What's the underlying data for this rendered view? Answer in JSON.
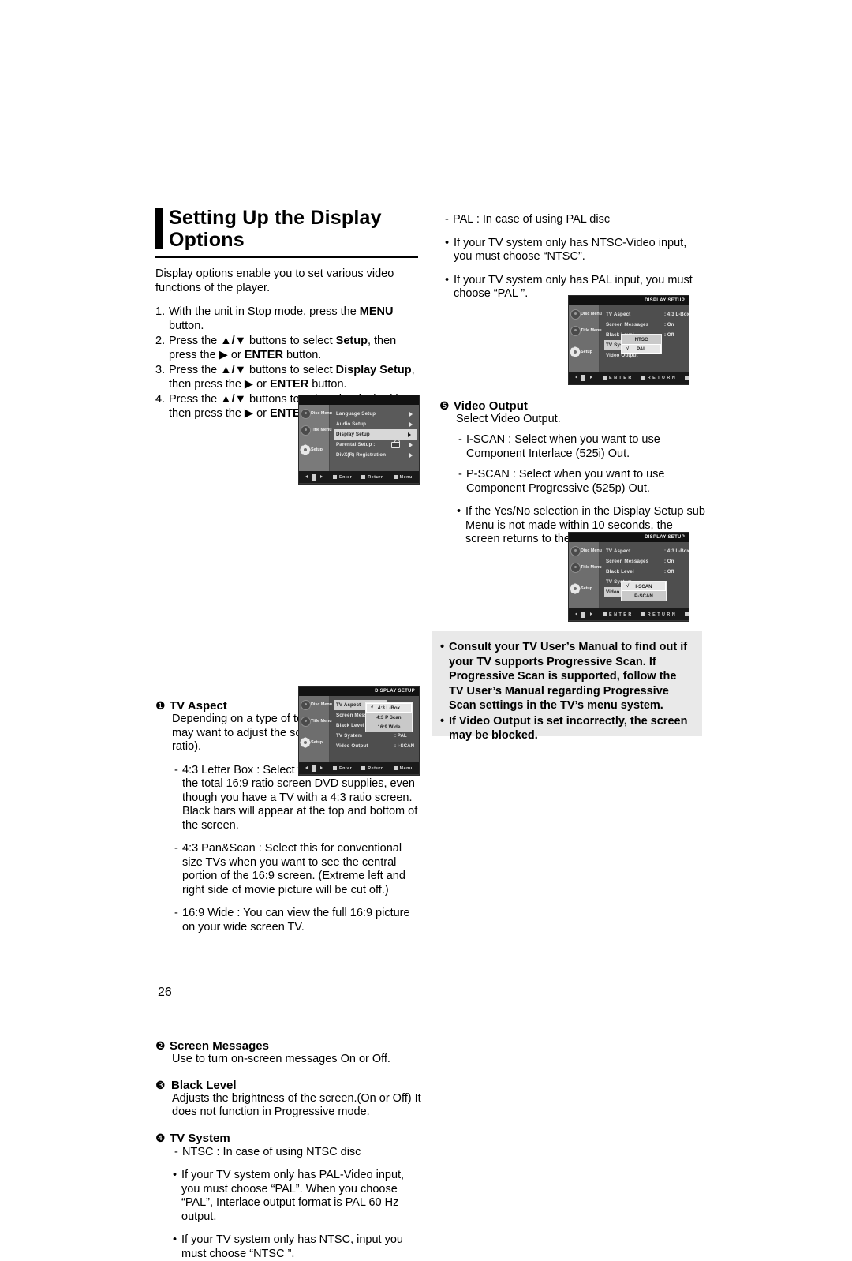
{
  "page": {
    "number": "26"
  },
  "heading": {
    "line1": "Setting Up the Display",
    "line2": "Options"
  },
  "intro": "Display options enable you to set various video functions of the player.",
  "steps": [
    {
      "num": "1.",
      "parts": [
        {
          "t": "With the unit in Stop mode, press the ",
          "b": false
        },
        {
          "t": "MENU",
          "b": true
        },
        {
          "t": " button.",
          "b": false
        }
      ]
    },
    {
      "num": "2.",
      "parts": [
        {
          "t": "Press the ",
          "b": false
        },
        {
          "t": "▲/▼",
          "b": true
        },
        {
          "t": " buttons to select ",
          "b": false
        },
        {
          "t": "Setup",
          "b": true
        },
        {
          "t": ", then press the ▶ or ",
          "b": false
        },
        {
          "t": "ENTER",
          "b": true
        },
        {
          "t": " button.",
          "b": false
        }
      ]
    },
    {
      "num": "3.",
      "parts": [
        {
          "t": "Press the ",
          "b": false
        },
        {
          "t": "▲/▼",
          "b": true
        },
        {
          "t": " buttons to select ",
          "b": false
        },
        {
          "t": "Display Setup",
          "b": true
        },
        {
          "t": ", then press the ▶ or ",
          "b": false
        },
        {
          "t": "ENTER",
          "b": true
        },
        {
          "t": " button.",
          "b": false
        }
      ]
    },
    {
      "num": "4.",
      "parts": [
        {
          "t": "Press the ",
          "b": false
        },
        {
          "t": "▲/▼",
          "b": true
        },
        {
          "t": " buttons to select the desired item, then press the ▶ or ",
          "b": false
        },
        {
          "t": "ENTER",
          "b": true
        },
        {
          "t": " button.",
          "b": false
        }
      ]
    }
  ],
  "sections": {
    "tv_aspect": {
      "num": "❶",
      "title": "TV Aspect",
      "body": "Depending on a type of television you have, you may want to adjust the screen setting (aspect ratio).",
      "items": [
        {
          "mark": "-",
          "text": "4:3 Letter Box : Select when you want to see the total 16:9 ratio screen DVD supplies, even though you have a TV with a 4:3 ratio screen. Black bars will appear at the top and bottom of the screen."
        },
        {
          "mark": "-",
          "text": "4:3 Pan&Scan : Select this for conventional size TVs when you want to see the central portion of the 16:9 screen. (Extreme left and right side of movie picture will be cut off.)"
        },
        {
          "mark": "-",
          "text": "16:9 Wide : You can view the full 16:9 picture on your wide screen TV."
        }
      ]
    },
    "screen_messages": {
      "num": "❷",
      "title": "Screen Messages",
      "body": "Use to turn on-screen messages On or Off."
    },
    "black_level": {
      "num": "❸",
      "title": "Black Level",
      "body": "Adjusts the brightness of the screen.(On or Off) It does not function in Progressive mode."
    },
    "tv_system": {
      "num": "❹",
      "title": "TV System",
      "dash": {
        "mark": "-",
        "text": "NTSC : In case of using NTSC disc"
      },
      "bullets": [
        {
          "mark": "•",
          "text": "If your TV system only has PAL-Video input, you must choose “PAL”. When you choose “PAL”, Interlace output format is PAL 60 Hz output."
        },
        {
          "mark": "•",
          "text": "If your TV system only has NTSC, input you must choose “NTSC ”."
        }
      ]
    },
    "tv_system_cont": {
      "dash": {
        "mark": "-",
        "text": "PAL : In case of using PAL disc"
      },
      "bullets": [
        {
          "mark": "•",
          "text": "If your TV system only has NTSC-Video input, you must choose “NTSC”."
        },
        {
          "mark": "•",
          "text": "If your TV system only has PAL input, you must choose “PAL ”."
        }
      ]
    },
    "video_output": {
      "num": "❺",
      "title": "Video Output",
      "body": "Select Video Output.",
      "items": [
        {
          "mark": "-",
          "text": "I-SCAN : Select when you want to use Component Interlace (525i) Out."
        },
        {
          "mark": "-",
          "text": "P-SCAN : Select when you want to use Component Progressive (525p) Out."
        }
      ],
      "bullets": [
        {
          "mark": "•",
          "text": "If the Yes/No selection in the Display Setup sub Menu is not made within 10 seconds, the screen returns to the previous menu."
        }
      ]
    }
  },
  "notice": {
    "items": [
      {
        "mark": "•",
        "text": "Consult your TV User’s Manual to find out if your TV supports Progressive Scan. If Progressive Scan is supported, follow the TV User’s Manual regarding Progressive Scan settings in the TV’s menu system."
      },
      {
        "mark": "•",
        "text": "If Video Output is set incorrectly, the screen may be blocked."
      }
    ]
  },
  "osd_common": {
    "side": {
      "disc_menu": "Disc Menu",
      "title_menu": "Title Menu",
      "setup": "Setup"
    },
    "footer_lower": {
      "enter": "Enter",
      "return": "Return",
      "menu": "Menu"
    },
    "footer_upper": {
      "enter": "E N T E R",
      "return": "R E T U R N",
      "menu": "M E N U"
    },
    "title": "DISPLAY SETUP"
  },
  "osd_setup_menu": {
    "rows": [
      {
        "label": "Language Setup",
        "selected": false
      },
      {
        "label": "Audio Setup",
        "selected": false
      },
      {
        "label": "Display Setup",
        "selected": true
      },
      {
        "label": "Parental Setup :",
        "selected": false,
        "lock": true
      },
      {
        "label": "DivX(R) Registration",
        "selected": false
      }
    ]
  },
  "osd_tv_aspect": {
    "title": "DISPLAY SETUP",
    "rows": [
      {
        "label": "TV Aspect",
        "value": "",
        "selected": true
      },
      {
        "label": "Screen Messages",
        "value": "",
        "selected": false
      },
      {
        "label": "Black Level",
        "value": "",
        "selected": false
      },
      {
        "label": "TV System",
        "value": ": PAL",
        "selected": false
      },
      {
        "label": "Video Output",
        "value": ": I-SCAN",
        "selected": false
      }
    ],
    "popup": [
      {
        "text": "4:3 L-Box",
        "checked": true
      },
      {
        "text": "4:3 P Scan",
        "checked": false
      },
      {
        "text": "16:9 Wide",
        "checked": false
      }
    ]
  },
  "osd_tv_system": {
    "title": "DISPLAY SETUP",
    "rows": [
      {
        "label": "TV Aspect",
        "value": ": 4:3 L-Box",
        "selected": false
      },
      {
        "label": "Screen Messages",
        "value": ": On",
        "selected": false
      },
      {
        "label": "Black Level",
        "value": ": Off",
        "selected": false
      },
      {
        "label": "TV System",
        "value": "",
        "selected": true
      },
      {
        "label": "Video Output",
        "value": "",
        "selected": false
      }
    ],
    "popup": [
      {
        "text": "NTSC",
        "checked": false
      },
      {
        "text": "PAL",
        "checked": true
      }
    ]
  },
  "osd_video_output": {
    "title": "DISPLAY SETUP",
    "rows": [
      {
        "label": "TV Aspect",
        "value": ": 4:3 L-Box",
        "selected": false
      },
      {
        "label": "Screen Messages",
        "value": ": On",
        "selected": false
      },
      {
        "label": "Black Level",
        "value": ": Off",
        "selected": false
      },
      {
        "label": "TV System",
        "value": "",
        "selected": false
      },
      {
        "label": "Video Output",
        "value": "",
        "selected": true
      }
    ],
    "popup": [
      {
        "text": "I-SCAN",
        "checked": true
      },
      {
        "text": "P-SCAN",
        "checked": false
      }
    ]
  }
}
